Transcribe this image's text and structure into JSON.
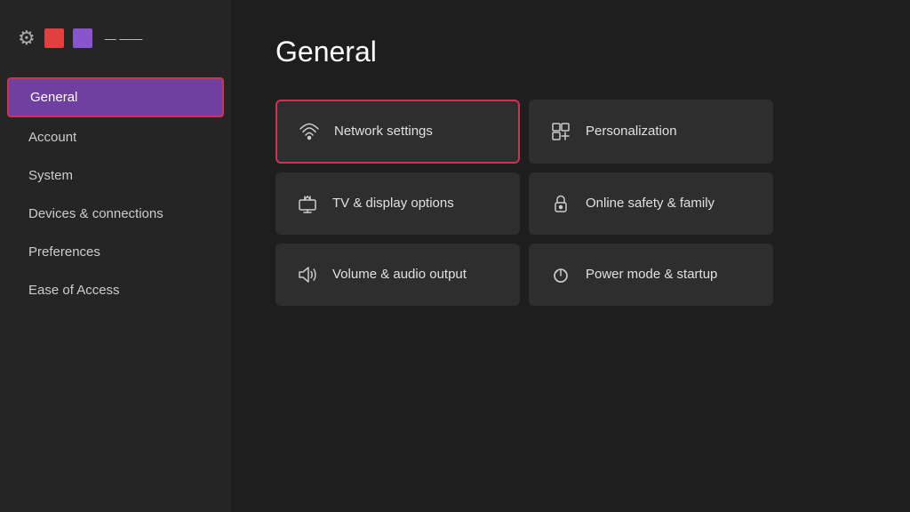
{
  "sidebar": {
    "header": {
      "account_name": "— ——"
    },
    "items": [
      {
        "id": "general",
        "label": "General",
        "active": true
      },
      {
        "id": "account",
        "label": "Account",
        "active": false
      },
      {
        "id": "system",
        "label": "System",
        "active": false
      },
      {
        "id": "devices",
        "label": "Devices & connections",
        "active": false
      },
      {
        "id": "preferences",
        "label": "Preferences",
        "active": false
      },
      {
        "id": "ease",
        "label": "Ease of Access",
        "active": false
      }
    ]
  },
  "main": {
    "title": "General",
    "tiles": [
      {
        "id": "network",
        "label": "Network settings",
        "icon": "network",
        "highlighted": true
      },
      {
        "id": "personalization",
        "label": "Personalization",
        "icon": "personalization",
        "highlighted": false
      },
      {
        "id": "tv-display",
        "label": "TV & display options",
        "icon": "tv",
        "highlighted": false
      },
      {
        "id": "online-safety",
        "label": "Online safety & family",
        "icon": "lock",
        "highlighted": false
      },
      {
        "id": "volume",
        "label": "Volume & audio output",
        "icon": "volume",
        "highlighted": false
      },
      {
        "id": "power",
        "label": "Power mode & startup",
        "icon": "power",
        "highlighted": false
      }
    ]
  }
}
